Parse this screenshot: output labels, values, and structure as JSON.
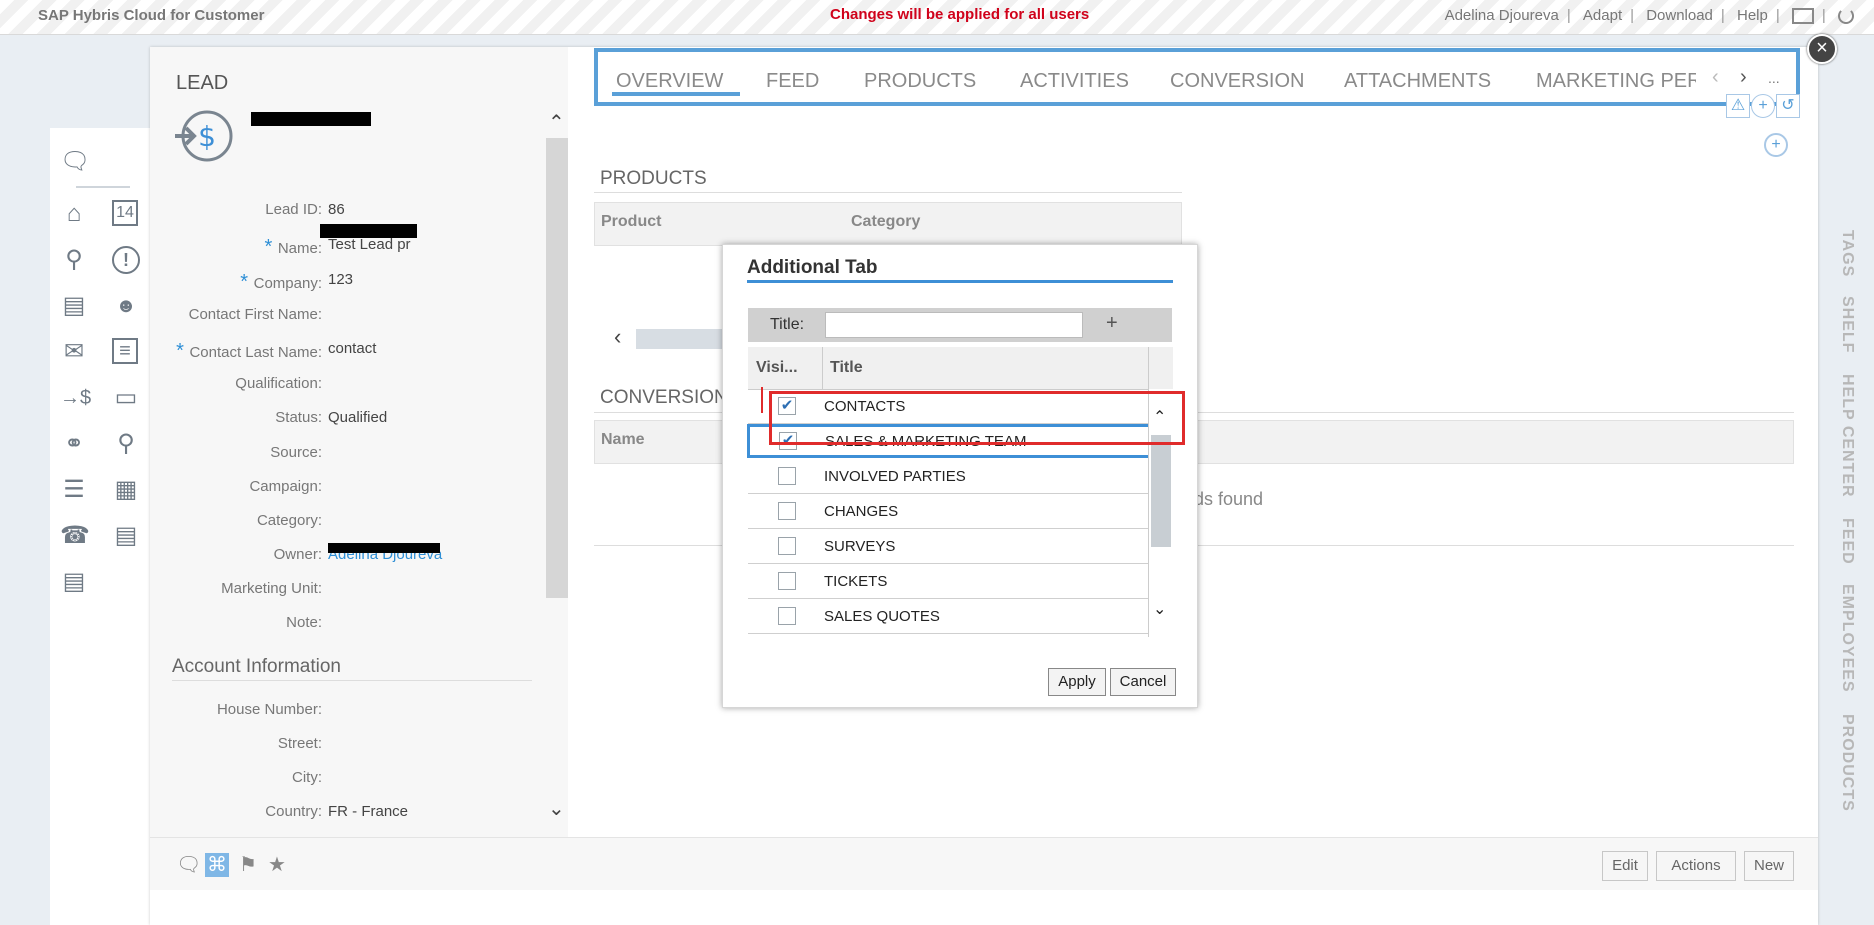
{
  "topbar": {
    "brand": "SAP Hybris Cloud for Customer",
    "warning": "Changes will be applied for all users",
    "user": "Adelina Djoureva",
    "adapt": "Adapt",
    "download": "Download",
    "help": "Help",
    "separator": "|"
  },
  "lead": {
    "heading": "LEAD",
    "name_partial": "Test Lead pr"
  },
  "fields": [
    {
      "label": "Lead ID:",
      "value": "86",
      "required": false
    },
    {
      "label": "Name:",
      "value": "Test Lead pr",
      "required": true
    },
    {
      "label": "Company:",
      "value": "123",
      "required": true
    },
    {
      "label": "Contact First Name:",
      "value": "",
      "required": false
    },
    {
      "label": "Contact Last Name:",
      "value": "contact",
      "required": true
    },
    {
      "label": "Qualification:",
      "value": "",
      "required": false
    },
    {
      "label": "Status:",
      "value": "Qualified",
      "required": false
    },
    {
      "label": "Source:",
      "value": "",
      "required": false
    },
    {
      "label": "Campaign:",
      "value": "",
      "required": false
    },
    {
      "label": "Category:",
      "value": "",
      "required": false
    },
    {
      "label": "Owner:",
      "value": "Adelina Djoureva",
      "required": false
    },
    {
      "label": "Marketing Unit:",
      "value": "",
      "required": false
    },
    {
      "label": "Note:",
      "value": "",
      "required": false
    }
  ],
  "account": {
    "heading": "Account Information",
    "fields": [
      {
        "label": "House Number:",
        "value": ""
      },
      {
        "label": "Street:",
        "value": ""
      },
      {
        "label": "City:",
        "value": ""
      },
      {
        "label": "Country:",
        "value": "FR - France"
      }
    ]
  },
  "tabs": [
    "OVERVIEW",
    "FEED",
    "PRODUCTS",
    "ACTIVITIES",
    "CONVERSION",
    "ATTACHMENTS",
    "MARKETING PER"
  ],
  "tabs_more": "...",
  "products": {
    "heading": "PRODUCTS",
    "col_product": "Product",
    "col_category": "Category"
  },
  "conversion": {
    "heading": "CONVERSION",
    "col_name": "Name",
    "no_records": "ds found"
  },
  "side_labels": [
    "TAGS",
    "SHELF",
    "HELP CENTER",
    "FEED",
    "EMPLOYEES",
    "PRODUCTS"
  ],
  "bottom": {
    "edit": "Edit",
    "actions": "Actions",
    "new": "New"
  },
  "dialog": {
    "title": "Additional Tab",
    "title_label": "Title:",
    "title_value": "",
    "add_symbol": "+",
    "col_visible": "Visi...",
    "col_title": "Title",
    "rows": [
      {
        "label": "CONTACTS",
        "checked": true
      },
      {
        "label": "SALES & MARKETING TEAM",
        "checked": true
      },
      {
        "label": "INVOLVED PARTIES",
        "checked": false
      },
      {
        "label": "CHANGES",
        "checked": false
      },
      {
        "label": "SURVEYS",
        "checked": false
      },
      {
        "label": "TICKETS",
        "checked": false
      },
      {
        "label": "SALES QUOTES",
        "checked": false
      }
    ],
    "apply": "Apply",
    "cancel": "Cancel"
  },
  "colors": {
    "accent": "#3d8fd6",
    "highlight": "#e02b2b",
    "warning": "#d0021b"
  }
}
